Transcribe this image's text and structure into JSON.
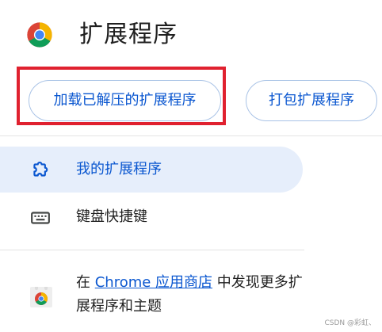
{
  "header": {
    "logo_icon": "chrome-logo-icon",
    "title": "扩展程序"
  },
  "toolbar": {
    "load_unpacked_label": "加载已解压的扩展程序",
    "pack_label": "打包扩展程序",
    "highlight_color": "#e0212f"
  },
  "nav": {
    "items": [
      {
        "label": "我的扩展程序",
        "icon": "puzzle-piece-icon",
        "active": true
      },
      {
        "label": "键盘快捷键",
        "icon": "keyboard-icon",
        "active": false
      }
    ]
  },
  "store": {
    "prefix": "在 ",
    "link": "Chrome 应用商店",
    "suffix": " 中发现更多扩展程序和主题",
    "icon": "chrome-web-store-icon"
  },
  "watermark": "CSDN @彩虹、",
  "colors": {
    "accent": "#0b57d0",
    "active_bg": "#e6eefb",
    "button_border": "#a9c3e6"
  }
}
